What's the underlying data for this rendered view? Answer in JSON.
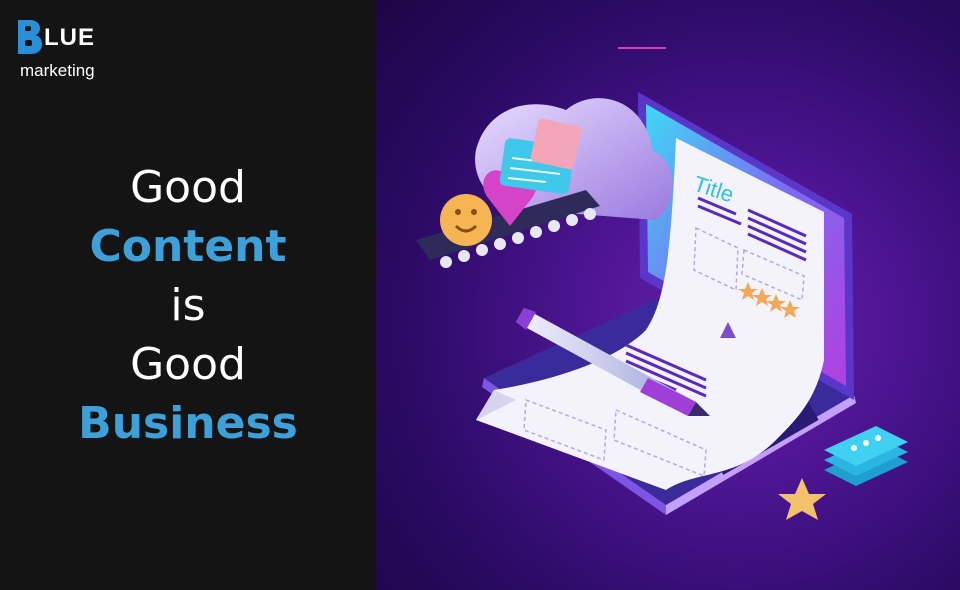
{
  "logo": {
    "word": "LUE",
    "sub": "marketing",
    "brand_color": "#2a8fd6"
  },
  "headline": {
    "line1": "Good",
    "line2": "Content",
    "line3": "is",
    "line4": "Good",
    "line5": "Business"
  },
  "illustration": {
    "document_title": "Title"
  },
  "colors": {
    "accent_blue": "#3ea0d8",
    "panel_dark": "#141414",
    "purple_bg": "#4a148f"
  }
}
